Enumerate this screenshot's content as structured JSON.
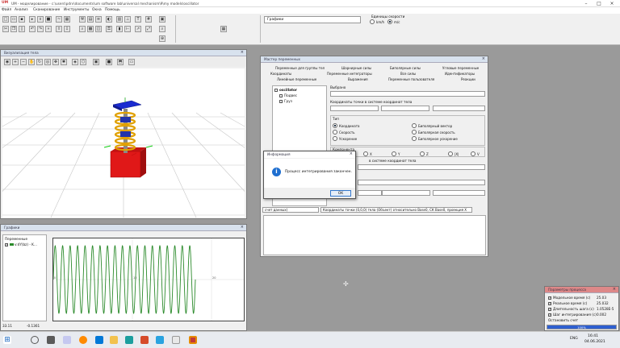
{
  "app": {
    "title": "UM - моделирование - c:\\users\\pdrv\\documents\\um software lab\\universal mechanism\\9\\my models\\oscillator",
    "logo_text": "UM"
  },
  "menu": [
    "Файл",
    "Анализ",
    "Сканирование",
    "Инструменты",
    "Окна",
    "Помощь"
  ],
  "toolbar": {
    "graph_select": "Графики",
    "speed_units": {
      "title": "Единицы скорости",
      "option_kmh": "km/h",
      "option_ms": "m/c",
      "selected": "m/c"
    }
  },
  "vis_window": {
    "title": "Визуализация тела"
  },
  "graph_window": {
    "title": "Графики",
    "vars_label": "Переменные",
    "var_item": "v:dY(bz) - K...",
    "status_left": "33.11",
    "status_right": "-0.1361",
    "chart_data": {
      "type": "line",
      "title": "",
      "x_ticks": [
        "0",
        "10",
        "20"
      ],
      "y_ticks": [
        "0"
      ],
      "series": [
        {
          "amplitude": 1.0,
          "cycles": 19,
          "x_range": [
            0,
            25
          ],
          "color": "#2a8a2a"
        }
      ],
      "grid": true
    }
  },
  "var_wizard": {
    "title": "Мастер переменных",
    "tabs_row1": [
      "Переменные для группы тел",
      "Шарнирные силы",
      "Биполярные силы",
      "Угловые переменные"
    ],
    "tabs_row2": [
      "Координаты",
      "Переменные интеграторы",
      "Все силы",
      "Идентификаторы"
    ],
    "tabs_row3": [
      "Линейные переменные",
      "Выражения",
      "Переменные пользователя",
      "Реакции"
    ],
    "tree_root": "oscillator",
    "tree_items": [
      "Подвес",
      "Груз"
    ],
    "selected_label": "Выбрано",
    "coords_label": "Координаты точки в системе координат тела",
    "type_label": "Тип",
    "type_options": [
      "Координата",
      "Скорость",
      "Ускорение"
    ],
    "type_options_right": [
      "Биполярный вектор",
      "Биполярная скорость",
      "Биполярное ускорение"
    ],
    "component_label": "Компонента",
    "components": [
      "X",
      "Y",
      "Z",
      "|X|",
      "V"
    ],
    "system_label": "в системе координат тела",
    "footer_left": "счет данных)",
    "footer_text": "Координаты точки (0,0,0) тела (Объект) относительно Base0, СК Base0, проекция X"
  },
  "info_dialog": {
    "title": "Информация",
    "message": "Процесс интегрирования закончен.",
    "ok_label": "OK"
  },
  "params_window": {
    "title": "Параметры процесса",
    "rows": [
      {
        "label": "Модельное время (с)",
        "value": "25.03"
      },
      {
        "label": "Реальное время (с)",
        "value": "25.032"
      },
      {
        "label": "Длительность шага (с)",
        "value": "1.0528E-5"
      },
      {
        "label": "Шаг интегрирования (с)",
        "value": "0.002"
      }
    ],
    "stop_label": "Остановить счет",
    "progress_text": "100%",
    "progress": 1.0
  },
  "taskbar": {
    "lang": "ENG",
    "time": "16:41",
    "date": "04.06.2021"
  }
}
